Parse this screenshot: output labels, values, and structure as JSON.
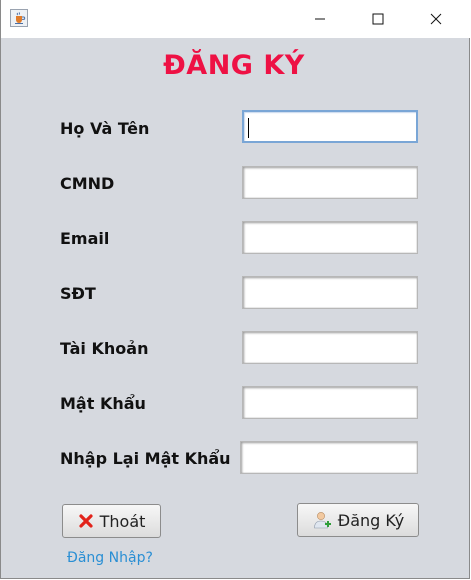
{
  "window": {
    "icon": "java-cup-icon",
    "controls": {
      "minimize": "minimize-icon",
      "maximize": "maximize-icon",
      "close": "close-icon"
    }
  },
  "form": {
    "title": "ĐĂNG KÝ",
    "title_color": "#ee1144",
    "fields": [
      {
        "label": "Họ Và Tên",
        "value": ""
      },
      {
        "label": "CMND",
        "value": ""
      },
      {
        "label": "Email",
        "value": ""
      },
      {
        "label": "SĐT",
        "value": ""
      },
      {
        "label": "Tài Khoản",
        "value": ""
      },
      {
        "label": "Mật Khẩu",
        "value": ""
      },
      {
        "label": "Nhập Lại Mật Khẩu",
        "value": ""
      }
    ]
  },
  "buttons": {
    "exit_label": "Thoát",
    "exit_icon": "red-x-icon",
    "register_label": "Đăng Ký",
    "register_icon": "add-user-icon"
  },
  "login_link": "Đăng Nhập?",
  "link_color": "#2a8fd4"
}
